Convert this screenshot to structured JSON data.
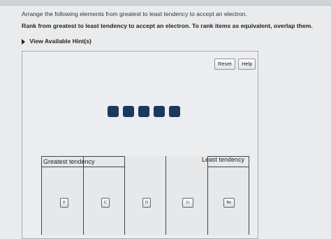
{
  "instruction": "Arrange the following elements from greatest to least tendency to accept an electron.",
  "rank_prompt": "Rank from greatest to least tendency to accept an electron.  To rank items as equivalent, overlap them.",
  "hint_link": "View Available Hint(s)",
  "buttons": {
    "reset": "Reset",
    "help": "Help"
  },
  "ranking": {
    "greatest_label": "Greatest tendency",
    "least_label": "Least tendency",
    "placed_items": [
      "F",
      "C",
      "O",
      "Li",
      "Be"
    ]
  },
  "remaining_tile_count": 5,
  "colors": {
    "tile": "#1c3860",
    "accent": "#1c3860"
  }
}
